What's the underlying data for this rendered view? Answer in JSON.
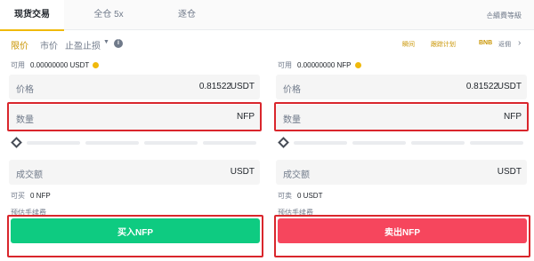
{
  "tabs": {
    "spot": "现货交易",
    "cross": "全仓 5x",
    "isolated": "逐仓",
    "fee_link": "손續費等級"
  },
  "order_types": {
    "limit": "限价",
    "market": "市价",
    "stop": "止盈止损",
    "right_links": [
      "瞬间",
      "跟踪计划",
      "BNB",
      "返佣"
    ]
  },
  "buy": {
    "available_label": "可用",
    "available_value": "0.00000000 USDT",
    "price_label": "价格",
    "price_value": "0.81522",
    "price_unit": "USDT",
    "qty_label": "数量",
    "qty_unit": "NFP",
    "total_label": "成交额",
    "total_unit": "USDT",
    "can_label": "可买",
    "can_value": "0 NFP",
    "fee_label": "预估手续费",
    "button_label": "买入NFP"
  },
  "sell": {
    "available_label": "可用",
    "available_value": "0.00000000 NFP",
    "price_label": "价格",
    "price_value": "0.81522",
    "price_unit": "USDT",
    "qty_label": "数量",
    "qty_unit": "NFP",
    "total_label": "成交额",
    "total_unit": "USDT",
    "can_label": "可卖",
    "can_value": "0 USDT",
    "fee_label": "预估手续费",
    "button_label": "卖出NFP"
  },
  "colors": {
    "buy": "#0ecb81",
    "sell": "#f6465d",
    "accent": "#f0b90b",
    "highlight": "#d9262c"
  }
}
